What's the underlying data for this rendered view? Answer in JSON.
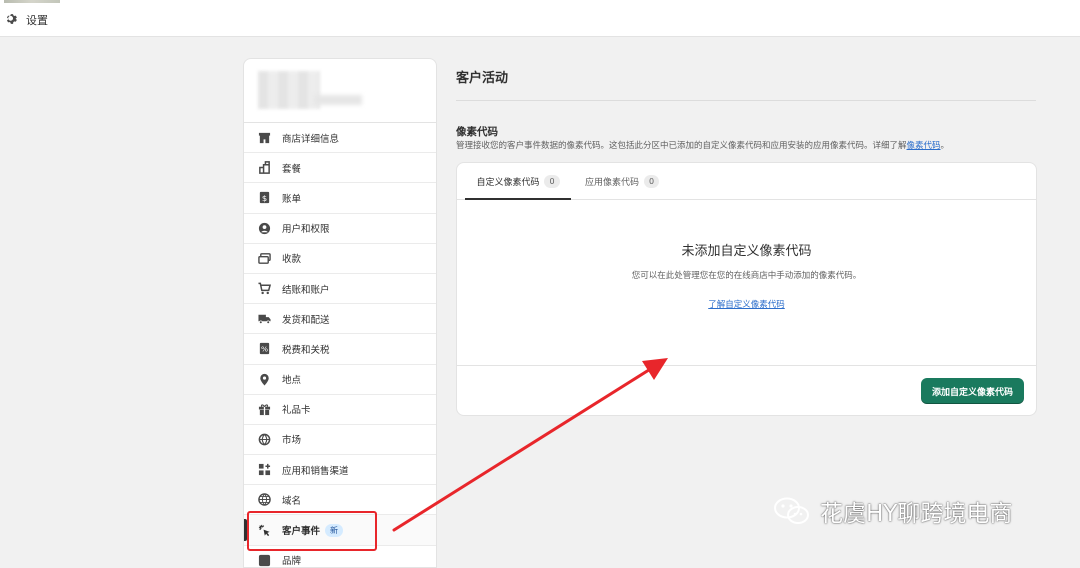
{
  "topbar": {
    "title": "设置"
  },
  "sidebar": {
    "items": [
      {
        "label": "商店详细信息",
        "icon": "store-icon"
      },
      {
        "label": "套餐",
        "icon": "plan-icon"
      },
      {
        "label": "账单",
        "icon": "billing-icon"
      },
      {
        "label": "用户和权限",
        "icon": "user-icon"
      },
      {
        "label": "收款",
        "icon": "payments-icon"
      },
      {
        "label": "结账和账户",
        "icon": "cart-icon"
      },
      {
        "label": "发货和配送",
        "icon": "truck-icon"
      },
      {
        "label": "税费和关税",
        "icon": "tax-icon"
      },
      {
        "label": "地点",
        "icon": "location-icon"
      },
      {
        "label": "礼品卡",
        "icon": "gift-icon"
      },
      {
        "label": "市场",
        "icon": "globe-icon"
      },
      {
        "label": "应用和销售渠道",
        "icon": "apps-icon"
      },
      {
        "label": "域名",
        "icon": "domain-icon"
      },
      {
        "label": "客户事件",
        "icon": "cursor-click-icon",
        "badge": "新",
        "active": true
      },
      {
        "label": "品牌",
        "icon": "brand-icon"
      }
    ]
  },
  "main": {
    "title": "客户活动",
    "section": {
      "title": "像素代码",
      "description": "管理接收您的客户事件数据的像素代码。这包括此分区中已添加的自定义像素代码和应用安装的应用像素代码。详细了解",
      "link": "像素代码",
      "suffix": "。"
    },
    "tabs": [
      {
        "label": "自定义像素代码",
        "count": "0"
      },
      {
        "label": "应用像素代码",
        "count": "0"
      }
    ],
    "empty": {
      "title": "未添加自定义像素代码",
      "description": "您可以在此处管理您在您的在线商店中手动添加的像素代码。",
      "link": "了解自定义像素代码"
    },
    "add_button": "添加自定义像素代码"
  },
  "watermark": {
    "text": "花虞HY聊跨境电商",
    "icon": "wechat-icon"
  },
  "colors": {
    "primary": "#1a7a5e",
    "link": "#2c6ecb",
    "annotation": "#e8262b"
  }
}
